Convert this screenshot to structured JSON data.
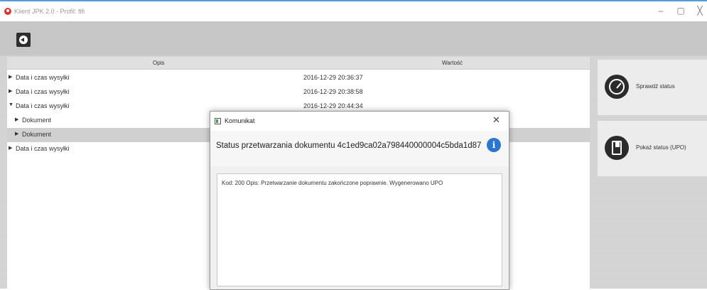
{
  "window": {
    "title": "Klient JPK 2.0 - Profil: fifi",
    "minimize_glyph": "–",
    "maximize_glyph": "▢",
    "close_glyph": "╳"
  },
  "table": {
    "columns": [
      "Opis",
      "Wartość"
    ],
    "rows": [
      {
        "arrow": "▶",
        "label": "Data i czas wysyłki",
        "value": "2016-12-29 20:36:37"
      },
      {
        "arrow": "▶",
        "label": "Data i czas wysyłki",
        "value": "2016-12-29 20:38:58"
      },
      {
        "arrow": "▼",
        "label": "Data i czas wysyłki",
        "value": "2016-12-29 20:44:34"
      },
      {
        "arrow": "▶",
        "label": "Dokument",
        "value": ""
      },
      {
        "arrow": "▶",
        "label": "Dokument",
        "value": ""
      },
      {
        "arrow": "▶",
        "label": "Data i czas wysyłki",
        "value": ""
      }
    ]
  },
  "side_buttons": {
    "check_status": "Sprawdź status",
    "show_upo": "Pokaż status (UPO)"
  },
  "dialog": {
    "title": "Komunikat",
    "close_glyph": "✕",
    "status": "Status przetwarzania dokumentu 4c1ed9ca02a798440000004c5bda1d87",
    "info_glyph": "i",
    "message": "Kod: 200 Opis: Przetwarzanie dokumentu zakończone poprawnie. Wygenerowano UPO"
  },
  "colors": {
    "accent_blue": "#2a76d0",
    "app_icon_red": "#d9372b",
    "selected_row": "#d0d0d0"
  }
}
